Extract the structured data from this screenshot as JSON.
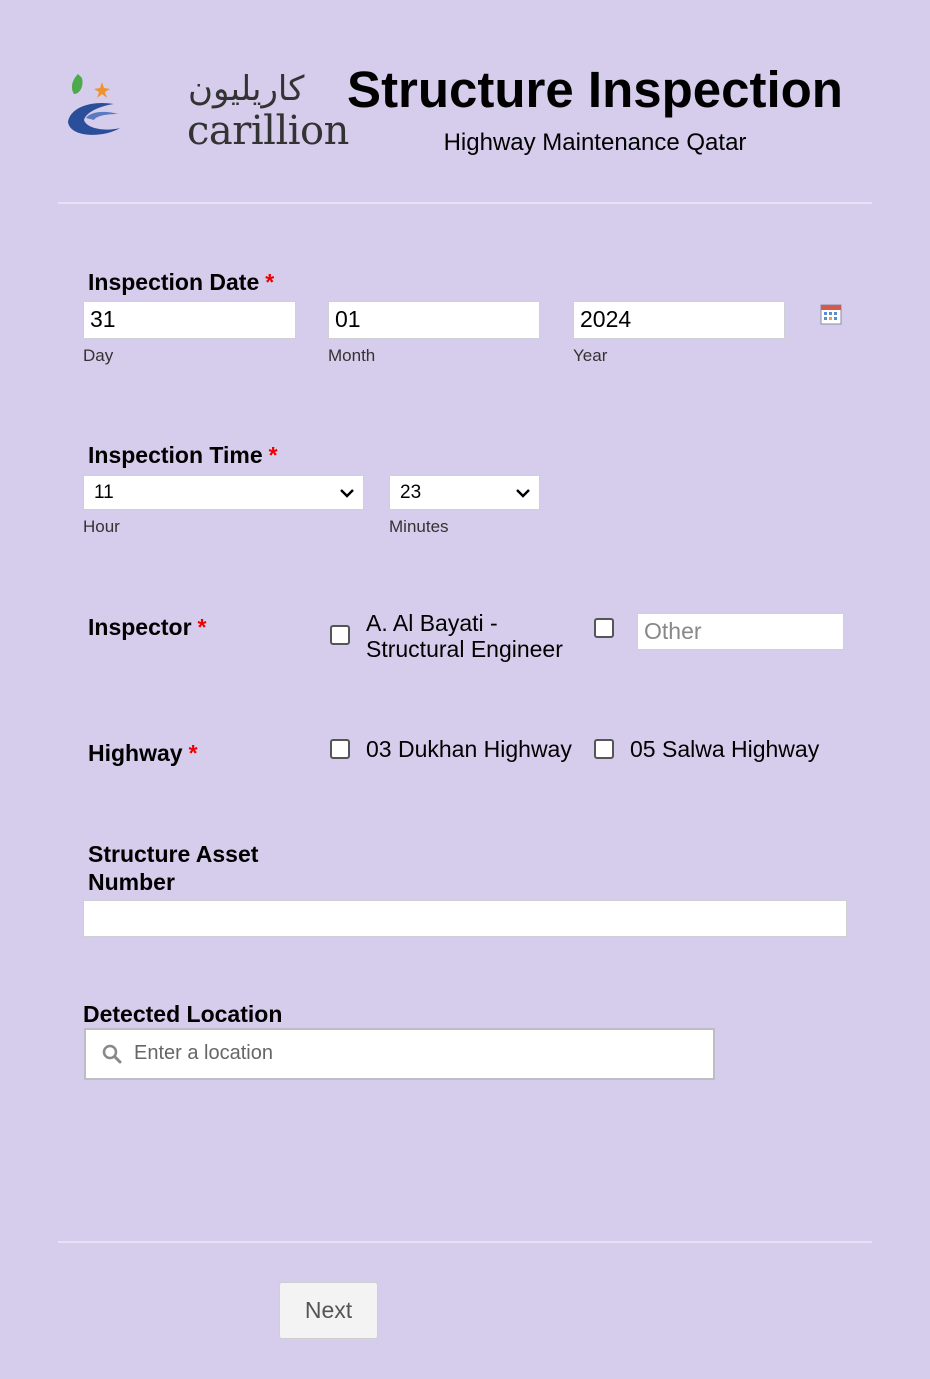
{
  "header": {
    "logo_arabic": "كاريليون",
    "logo_latin": "carillion",
    "title": "Structure Inspection",
    "subtitle": "Highway Maintenance Qatar"
  },
  "inspection_date": {
    "label": "Inspection Date",
    "required_mark": "*",
    "day": {
      "value": "31",
      "sublabel": "Day"
    },
    "month": {
      "value": "01",
      "sublabel": "Month"
    },
    "year": {
      "value": "2024",
      "sublabel": "Year"
    },
    "calendar_icon": "calendar-icon"
  },
  "inspection_time": {
    "label": "Inspection Time",
    "required_mark": "*",
    "hour": {
      "value": "11",
      "sublabel": "Hour"
    },
    "minutes": {
      "value": "23",
      "sublabel": "Minutes"
    }
  },
  "inspector": {
    "label": "Inspector",
    "required_mark": "*",
    "option_1": "A. Al Bayati - Structural Engineer",
    "other_placeholder": "Other"
  },
  "highway": {
    "label": "Highway",
    "required_mark": "*",
    "option_1": "03 Dukhan Highway",
    "option_2": "05 Salwa Highway"
  },
  "structure_asset": {
    "label": "Structure Asset Number",
    "value": ""
  },
  "detected_location": {
    "label": "Detected Location",
    "placeholder": "Enter a location"
  },
  "footer": {
    "next_label": "Next"
  },
  "colors": {
    "background": "#d6cdec",
    "required": "#e00000"
  }
}
